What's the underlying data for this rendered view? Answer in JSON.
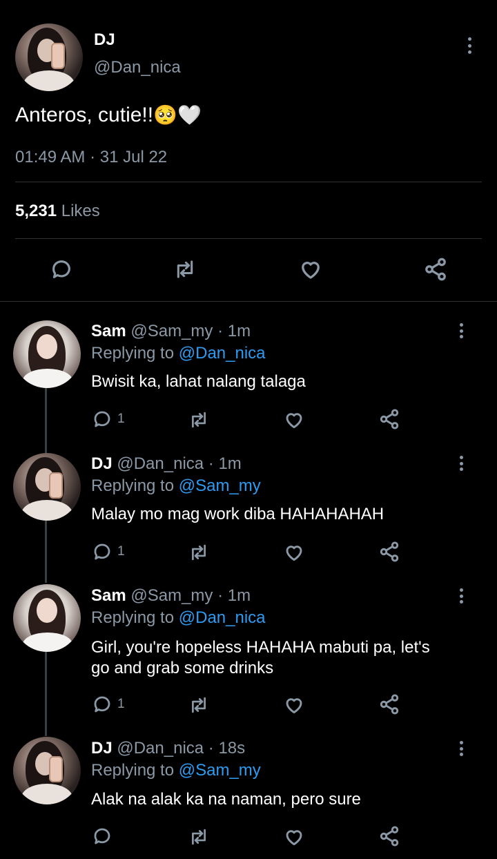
{
  "main_tweet": {
    "display_name": "DJ",
    "handle": "@Dan_nica",
    "text": "Anteros, cutie!!",
    "emoji": "🥺🤍",
    "timestamp": "01:49 AM · 31 Jul 22",
    "likes_count": "5,231",
    "likes_label": "Likes"
  },
  "replies": [
    {
      "display_name": "Sam",
      "handle": "@Sam_my",
      "time": "· 1m",
      "replying_prefix": "Replying to",
      "replying_to": "@Dan_nica",
      "text": "Bwisit ka, lahat nalang talaga",
      "reply_count": "1"
    },
    {
      "display_name": "DJ",
      "handle": "@Dan_nica",
      "time": "· 1m",
      "replying_prefix": "Replying to",
      "replying_to": "@Sam_my",
      "text": "Malay mo mag work diba HAHAHAHAH",
      "reply_count": "1"
    },
    {
      "display_name": "Sam",
      "handle": "@Sam_my",
      "time": "· 1m",
      "replying_prefix": "Replying to",
      "replying_to": "@Dan_nica",
      "text_line1": "Girl, you're hopeless HAHAHA mabuti pa, let's",
      "text_line2": "go and grab some drinks",
      "reply_count": "1"
    },
    {
      "display_name": "DJ",
      "handle": "@Dan_nica",
      "time": "· 18s",
      "replying_prefix": "Replying to",
      "replying_to": "@Sam_my",
      "text": "Alak na alak ka na naman, pero sure",
      "reply_count": ""
    }
  ],
  "colors": {
    "background": "#000000",
    "text": "#e7e9ea",
    "muted": "#8b98a5",
    "link": "#2f9bf0",
    "divider": "#2f3336"
  },
  "icons": [
    "more-icon",
    "reply-icon",
    "retweet-icon",
    "like-icon",
    "share-icon"
  ]
}
